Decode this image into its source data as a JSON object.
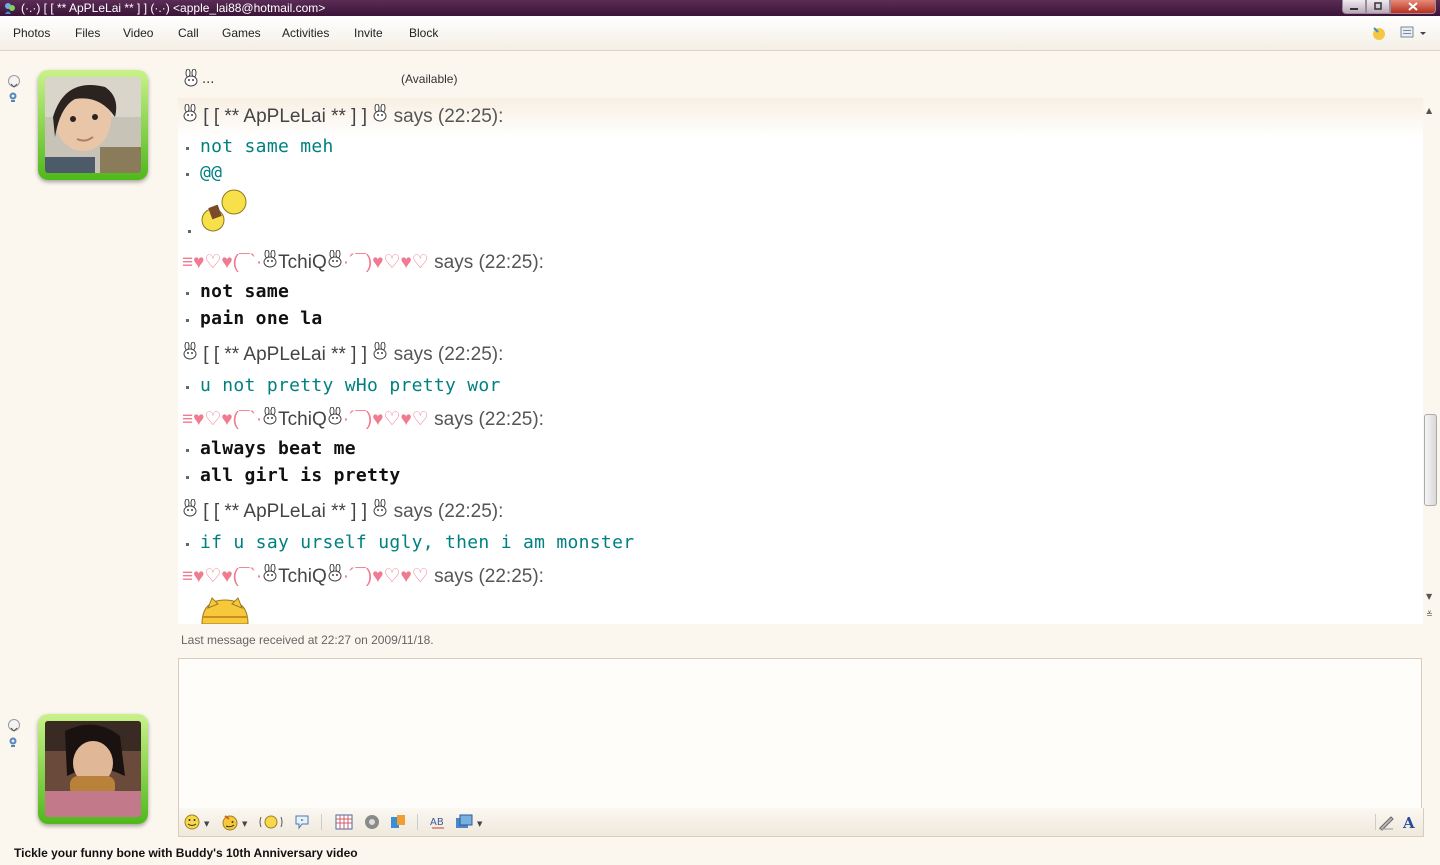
{
  "window": {
    "title": "(·.·) [ [ ** ApPLeLai ** ] ] (·.·) <apple_lai88@hotmail.com>"
  },
  "menu": {
    "items": [
      "Photos",
      "Files",
      "Video",
      "Call",
      "Games",
      "Activities",
      "Invite",
      "Block"
    ]
  },
  "contact": {
    "name_short": "...",
    "status": "(Available)"
  },
  "messages": {
    "m1": {
      "sender": "[ [ ** ApPLeLai ** ] ]",
      "says": "says (22:25):",
      "lines": [
        "not same meh",
        "@@"
      ]
    },
    "m2": {
      "sender_left": "≡♥♡♥(¯`·",
      "nick": "TchiQ",
      "sender_right": "·´¯)♥♡♥♡",
      "says": "says (22:25):",
      "lines": [
        "not same",
        "pain one la"
      ]
    },
    "m3": {
      "sender": "[ [ ** ApPLeLai ** ] ]",
      "says": "says (22:25):",
      "lines": [
        "u not pretty wHo pretty wor"
      ]
    },
    "m4": {
      "sender_left": "≡♥♡♥(¯`·",
      "nick": "TchiQ",
      "sender_right": "·´¯)♥♡♥♡",
      "says": "says (22:25):",
      "lines": [
        "always beat me",
        "all girl is pretty"
      ]
    },
    "m5": {
      "sender": "[ [ ** ApPLeLai ** ] ]",
      "says": "says (22:25):",
      "lines": [
        "if u say urself ugly, then i am monster"
      ]
    },
    "m6": {
      "sender_left": "≡♥♡♥(¯`·",
      "nick": "TchiQ",
      "sender_right": "·´¯)♥♡♥♡",
      "says": "says (22:25):"
    }
  },
  "footer": {
    "last_message": "Last message received at 22:27 on 2009/11/18.",
    "ad": "Tickle your funny bone with Buddy's 10th Anniversary video"
  },
  "colors": {
    "titlebar": "#3b1438",
    "teal_text": "#008080",
    "avatar_green": "#4fb81b",
    "pink_deco": "#f07a90"
  }
}
